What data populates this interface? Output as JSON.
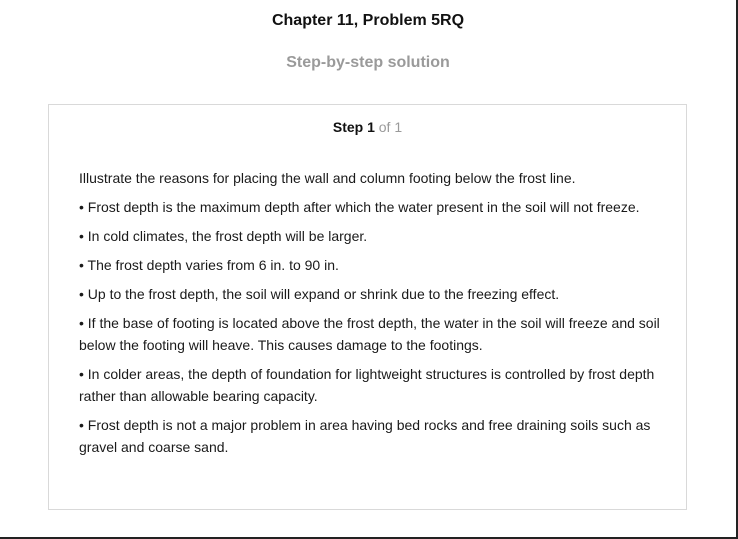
{
  "header": {
    "title": "Chapter 11, Problem 5RQ",
    "subtitle": "Step-by-step solution"
  },
  "step": {
    "label": "Step 1",
    "of_text": "of 1"
  },
  "content": {
    "intro": "Illustrate the reasons for placing the wall and column footing below the frost line.",
    "bullets": [
      "• Frost depth is the maximum depth after which the water present in the soil will not freeze.",
      "• In cold climates, the frost depth will be larger.",
      "• The frost depth varies from 6 in. to 90 in.",
      "• Up to the frost depth, the soil will expand or shrink due to the freezing effect.",
      "• If the base of footing is located above the frost depth, the water in the soil will freeze and soil below the footing will heave. This causes damage to the footings.",
      "• In colder areas, the depth of foundation for lightweight structures is controlled by frost depth rather than allowable bearing capacity.",
      "• Frost depth is not a major problem in area having bed rocks and free draining soils such as gravel and coarse sand."
    ]
  }
}
